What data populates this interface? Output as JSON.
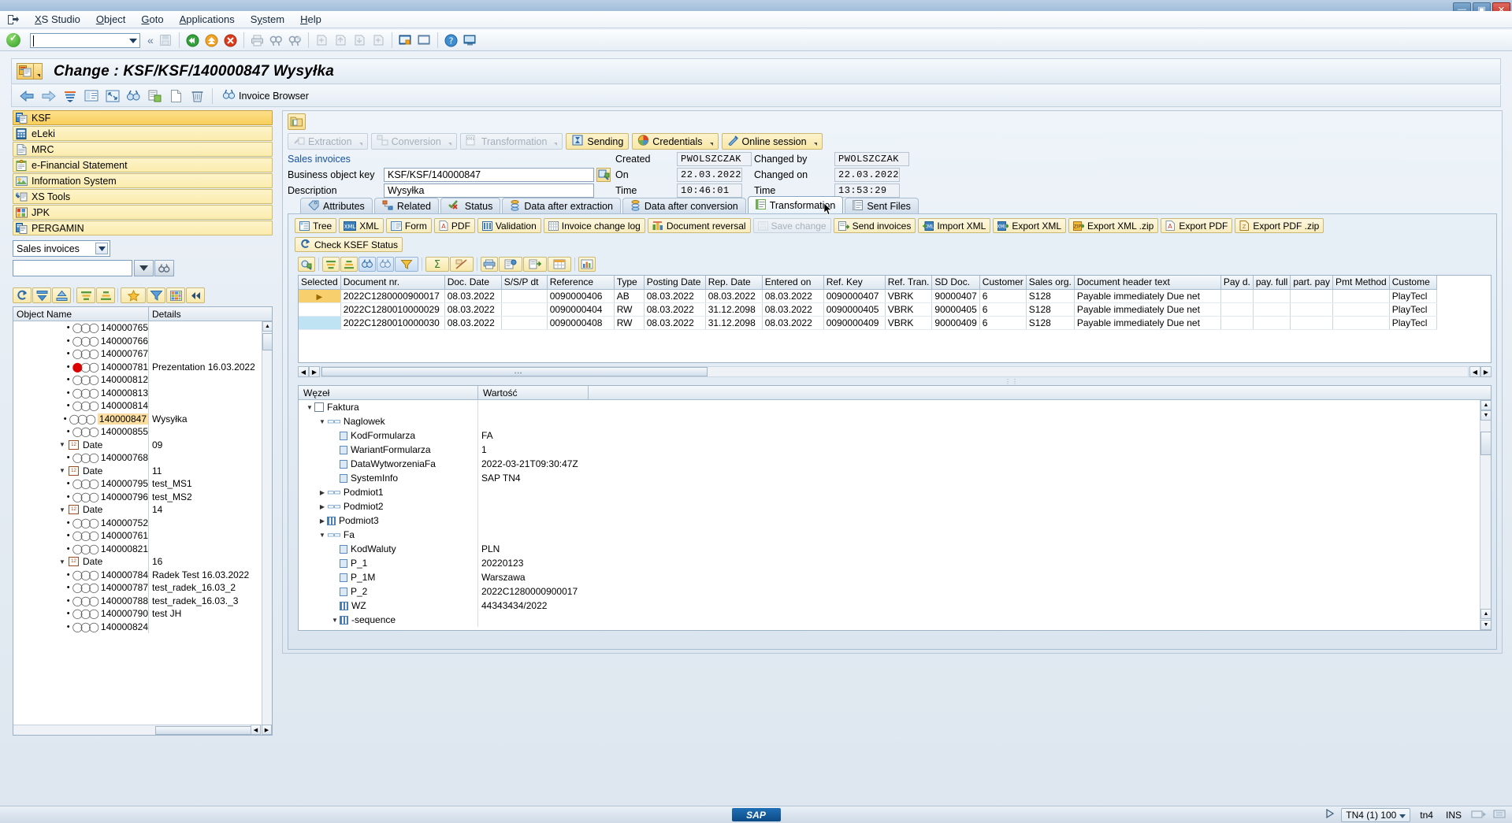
{
  "window": {
    "buttons": [
      "minimize",
      "maximize",
      "close"
    ]
  },
  "menubar": {
    "logo_icon": "sap-session-icon",
    "items": [
      "XS Studio",
      "Object",
      "Goto",
      "Applications",
      "System",
      "Help"
    ]
  },
  "toolbar": {
    "ok_icon": "green-check-icon",
    "command_field_value": "",
    "collapse_icon": "double-chevron-left-icon",
    "icons": [
      "save-icon",
      "back-icon",
      "exit-icon",
      "cancel-icon",
      "print-icon",
      "find-icon",
      "find-next-icon",
      "first-page-icon",
      "previous-page-icon",
      "next-page-icon",
      "last-page-icon",
      "create-session-icon",
      "create-shortcut-icon",
      "help-icon",
      "customize-icon"
    ]
  },
  "page": {
    "title": "Change : KSF/KSF/140000847 Wysyłka",
    "title_icon": "application-icon"
  },
  "app_toolbar": {
    "icons": [
      "back-arrow-icon",
      "forward-arrow-icon",
      "sort-icon",
      "detail-icon",
      "expand-icon",
      "find-binoculars-icon",
      "copy-document-icon",
      "new-document-icon",
      "delete-trash-icon"
    ],
    "invoice_browser": {
      "label": "Invoice Browser",
      "icon": "binoculars-icon"
    }
  },
  "sidebar": {
    "nav_items": [
      {
        "label": "KSF",
        "icon": "ksf-icon",
        "active": true
      },
      {
        "label": "eLeki",
        "icon": "eleki-icon",
        "active": false
      },
      {
        "label": "MRC",
        "icon": "mrc-document-icon",
        "active": false
      },
      {
        "label": "e-Financial Statement",
        "icon": "financial-statement-icon",
        "active": false
      },
      {
        "label": "Information System",
        "icon": "information-system-icon",
        "active": false
      },
      {
        "label": "XS Tools",
        "icon": "xs-tools-wrench-icon",
        "active": false
      },
      {
        "label": "JPK",
        "icon": "jpk-icon",
        "active": false
      },
      {
        "label": "PERGAMIN",
        "icon": "pergamin-icon",
        "active": false
      }
    ],
    "object_type_select": {
      "value": "Sales invoices",
      "dropdown_icon": "chevron-down-icon"
    },
    "search_value": "",
    "search_dropdown_icon": "chevron-down-icon",
    "search_button_icon": "binoculars-search-icon",
    "tree_toolbar_icons": [
      "refresh-icon",
      "expand-all-icon",
      "collapse-all-icon",
      "sort-ascending-icon",
      "sort-descending-icon",
      "favorites-star-icon",
      "filter-icon",
      "layout-grid-icon",
      "collapse-panel-icon"
    ],
    "tree": {
      "columns": [
        "Object Name",
        "Details"
      ],
      "rows": [
        {
          "indent": 2,
          "icon": "status-ooo-icon",
          "status": "none",
          "name": "140000765",
          "details": ""
        },
        {
          "indent": 2,
          "icon": "status-ooo-icon",
          "status": "none",
          "name": "140000766",
          "details": ""
        },
        {
          "indent": 2,
          "icon": "status-ooo-icon",
          "status": "none",
          "name": "140000767",
          "details": ""
        },
        {
          "indent": 2,
          "icon": "status-ooo-icon",
          "status": "red",
          "name": "140000781",
          "details": "Prezentation 16.03.2022"
        },
        {
          "indent": 2,
          "icon": "status-ooo-icon",
          "status": "none",
          "name": "140000812",
          "details": ""
        },
        {
          "indent": 2,
          "icon": "status-ooo-icon",
          "status": "none",
          "name": "140000813",
          "details": ""
        },
        {
          "indent": 2,
          "icon": "status-ooo-icon",
          "status": "none",
          "name": "140000814",
          "details": ""
        },
        {
          "indent": 2,
          "icon": "status-ooo-icon",
          "status": "none",
          "name": "140000847",
          "details": "Wysyłka",
          "selected": true
        },
        {
          "indent": 2,
          "icon": "status-ooo-icon",
          "status": "none",
          "name": "140000855",
          "details": ""
        },
        {
          "indent": 1,
          "icon": "date-folder-icon",
          "twisty": "expanded",
          "name": "Date",
          "details": "09"
        },
        {
          "indent": 2,
          "icon": "status-ooo-icon",
          "status": "none",
          "name": "140000768",
          "details": ""
        },
        {
          "indent": 1,
          "icon": "date-folder-icon",
          "twisty": "expanded",
          "name": "Date",
          "details": "11"
        },
        {
          "indent": 2,
          "icon": "status-ooo-icon",
          "status": "none",
          "name": "140000795",
          "details": "test_MS1"
        },
        {
          "indent": 2,
          "icon": "status-ooo-icon",
          "status": "none",
          "name": "140000796",
          "details": "test_MS2"
        },
        {
          "indent": 1,
          "icon": "date-folder-icon",
          "twisty": "expanded",
          "name": "Date",
          "details": "14"
        },
        {
          "indent": 2,
          "icon": "status-ooo-icon",
          "status": "none",
          "name": "140000752",
          "details": ""
        },
        {
          "indent": 2,
          "icon": "status-ooo-icon",
          "status": "none",
          "name": "140000761",
          "details": ""
        },
        {
          "indent": 2,
          "icon": "status-ooo-icon",
          "status": "none",
          "name": "140000821",
          "details": ""
        },
        {
          "indent": 1,
          "icon": "date-folder-icon",
          "twisty": "expanded",
          "name": "Date",
          "details": "16"
        },
        {
          "indent": 2,
          "icon": "status-ooo-icon",
          "status": "none",
          "name": "140000784",
          "details": "Radek Test 16.03.2022"
        },
        {
          "indent": 2,
          "icon": "status-ooo-icon",
          "status": "none",
          "name": "140000787",
          "details": "test_radek_16.03_2"
        },
        {
          "indent": 2,
          "icon": "status-ooo-icon",
          "status": "none",
          "name": "140000788",
          "details": "test_radek_16.03._3"
        },
        {
          "indent": 2,
          "icon": "status-ooo-icon",
          "status": "none",
          "name": "140000790",
          "details": "test JH"
        },
        {
          "indent": 2,
          "icon": "status-ooo-icon",
          "status": "none",
          "name": "140000824",
          "details": ""
        }
      ]
    }
  },
  "main": {
    "folder_icon": "open-folder-icon",
    "stages": [
      {
        "label": "Extraction",
        "icon": "extraction-icon",
        "enabled": false,
        "has_dropdown": true
      },
      {
        "label": "Conversion",
        "icon": "conversion-icon",
        "enabled": false,
        "has_dropdown": true
      },
      {
        "label": "Transformation",
        "icon": "transformation-xml-icon",
        "enabled": false,
        "has_dropdown": true
      },
      {
        "label": "Sending",
        "icon": "sending-icon",
        "enabled": true,
        "has_dropdown": false
      },
      {
        "label": "Credentials",
        "icon": "credentials-pie-icon",
        "enabled": true,
        "has_dropdown": true
      },
      {
        "label": "Online session",
        "icon": "online-session-icon",
        "enabled": true,
        "has_dropdown": true
      }
    ],
    "form": {
      "object_link": "Sales invoices",
      "business_object_key_label": "Business object key",
      "business_object_key_value": "KSF/KSF/140000847",
      "description_label": "Description",
      "description_value": "Wysyłka",
      "search_icon": "search-help-icon",
      "created_label": "Created",
      "created_value": "PWOLSZCZAK",
      "on_label": "On",
      "on_value": "22.03.2022",
      "time_label": "Time",
      "time_value": "10:46:01",
      "changed_by_label": "Changed by",
      "changed_by_value": "PWOLSZCZAK",
      "changed_on_label": "Changed on",
      "changed_on_value": "22.03.2022",
      "changed_time_label": "Time",
      "changed_time_value": "13:53:29"
    },
    "tabs": [
      {
        "label": "Attributes",
        "icon": "attributes-tag-icon",
        "active": false
      },
      {
        "label": "Related",
        "icon": "related-nodes-icon",
        "active": false
      },
      {
        "label": "Status",
        "icon": "status-check-icon",
        "active": false
      },
      {
        "label": "Data after extraction",
        "icon": "data-stack-icon",
        "active": false
      },
      {
        "label": "Data after conversion",
        "icon": "data-stack-icon",
        "active": false
      },
      {
        "label": "Transformation",
        "icon": "transformation-list-icon",
        "active": true
      },
      {
        "label": "Sent Files",
        "icon": "sent-files-icon",
        "active": false
      }
    ],
    "action_buttons": [
      {
        "label": "Tree",
        "icon": "tree-icon",
        "enabled": true
      },
      {
        "label": "XML",
        "icon": "xml-icon",
        "enabled": true
      },
      {
        "label": "Form",
        "icon": "form-icon",
        "enabled": true
      },
      {
        "label": "PDF",
        "icon": "pdf-icon",
        "enabled": true
      },
      {
        "label": "Validation",
        "icon": "validation-icon",
        "enabled": true
      },
      {
        "label": "Invoice change log",
        "icon": "change-log-icon",
        "enabled": true
      },
      {
        "label": "Document reversal",
        "icon": "document-reversal-icon",
        "enabled": true
      },
      {
        "label": "Save change",
        "icon": "save-icon",
        "enabled": false
      },
      {
        "label": "Send invoices",
        "icon": "send-invoices-icon",
        "enabled": true
      },
      {
        "label": "Import XML",
        "icon": "import-xml-icon",
        "enabled": true
      },
      {
        "label": "Export XML",
        "icon": "export-xml-icon",
        "enabled": true
      },
      {
        "label": "Export XML .zip",
        "icon": "export-xml-zip-icon",
        "enabled": true
      },
      {
        "label": "Export PDF",
        "icon": "export-pdf-icon",
        "enabled": true
      },
      {
        "label": "Export PDF .zip",
        "icon": "export-pdf-zip-icon",
        "enabled": true
      }
    ],
    "action_buttons_row2": [
      {
        "label": "Check KSEF Status",
        "icon": "refresh-status-icon",
        "enabled": true
      }
    ],
    "grid_toolbar_icons": [
      "details-search-icon",
      "sort-ascending-icon",
      "sort-descending-icon",
      "find-icon",
      "find-next-icon",
      "filter-icon",
      "total-sum-icon",
      "subtotal-icon",
      "print-icon",
      "export-local-file-icon",
      "mail-export-icon",
      "spreadsheet-icon",
      "graphic-chart-icon"
    ],
    "grid": {
      "columns": [
        "Selected",
        "Document nr.",
        "Doc. Date",
        "S/S/P dt",
        "Reference",
        "Type",
        "Posting Date",
        "Rep. Date",
        "Entered on",
        "Ref. Key",
        "Ref. Tran.",
        "SD Doc.",
        "Customer",
        "Sales org.",
        "Document header text",
        "Pay d.",
        "pay. full",
        "part. pay",
        "Pmt Method",
        "Custome"
      ],
      "rows": [
        {
          "selected": true,
          "cells": [
            "2022C1280000900017",
            "08.03.2022",
            "",
            "0090000406",
            "AB",
            "08.03.2022",
            "08.03.2022",
            "08.03.2022",
            "0090000407",
            "VBRK",
            "90000407",
            "6",
            "S128",
            "Payable immediately Due net",
            "",
            "",
            "",
            "",
            "PlayTecl"
          ]
        },
        {
          "selected": false,
          "cells": [
            "2022C1280010000029",
            "08.03.2022",
            "",
            "0090000404",
            "RW",
            "08.03.2022",
            "31.12.2098",
            "08.03.2022",
            "0090000405",
            "VBRK",
            "90000405",
            "6",
            "S128",
            "Payable immediately Due net",
            "",
            "",
            "",
            "",
            "PlayTecl"
          ]
        },
        {
          "selected": false,
          "highlighted": true,
          "cells": [
            "2022C1280010000030",
            "08.03.2022",
            "",
            "0090000408",
            "RW",
            "08.03.2022",
            "31.12.2098",
            "08.03.2022",
            "0090000409",
            "VBRK",
            "90000409",
            "6",
            "S128",
            "Payable immediately Due net",
            "",
            "",
            "",
            "",
            "PlayTecl"
          ]
        }
      ]
    },
    "xml_tree": {
      "columns": [
        "Węzeł",
        "Wartość"
      ],
      "rows": [
        {
          "indent": 0,
          "twisty": "expanded",
          "icon": "xml-document-icon",
          "node": "Faktura",
          "value": ""
        },
        {
          "indent": 1,
          "twisty": "expanded",
          "icon": "xml-element-icon",
          "node": "Naglowek",
          "value": ""
        },
        {
          "indent": 2,
          "twisty": "none",
          "icon": "xml-attribute-icon",
          "node": "KodFormularza",
          "value": "FA"
        },
        {
          "indent": 2,
          "twisty": "none",
          "icon": "xml-attribute-icon",
          "node": "WariantFormularza",
          "value": "1"
        },
        {
          "indent": 2,
          "twisty": "none",
          "icon": "xml-attribute-icon",
          "node": "DataWytworzeniaFa",
          "value": "2022-03-21T09:30:47Z"
        },
        {
          "indent": 2,
          "twisty": "none",
          "icon": "xml-attribute-icon",
          "node": "SystemInfo",
          "value": "SAP TN4"
        },
        {
          "indent": 1,
          "twisty": "collapsed",
          "icon": "xml-element-icon",
          "node": "Podmiot1",
          "value": ""
        },
        {
          "indent": 1,
          "twisty": "collapsed",
          "icon": "xml-element-icon",
          "node": "Podmiot2",
          "value": ""
        },
        {
          "indent": 1,
          "twisty": "collapsed",
          "icon": "xml-table-icon",
          "node": "Podmiot3",
          "value": ""
        },
        {
          "indent": 1,
          "twisty": "expanded",
          "icon": "xml-element-icon",
          "node": "Fa",
          "value": ""
        },
        {
          "indent": 2,
          "twisty": "none",
          "icon": "xml-attribute-icon",
          "node": "KodWaluty",
          "value": "PLN"
        },
        {
          "indent": 2,
          "twisty": "none",
          "icon": "xml-attribute-icon",
          "node": "P_1",
          "value": "20220123"
        },
        {
          "indent": 2,
          "twisty": "none",
          "icon": "xml-attribute-icon",
          "node": "P_1M",
          "value": "Warszawa"
        },
        {
          "indent": 2,
          "twisty": "none",
          "icon": "xml-attribute-icon",
          "node": "P_2",
          "value": "2022C1280000900017"
        },
        {
          "indent": 2,
          "twisty": "none",
          "icon": "xml-table-icon",
          "node": "WZ",
          "value": "44343434/2022"
        },
        {
          "indent": 2,
          "twisty": "expanded",
          "icon": "xml-table-icon",
          "node": "-sequence",
          "value": ""
        }
      ]
    }
  },
  "statusbar": {
    "sap_logo": "SAP",
    "run_icon": "play-icon",
    "system": "TN4 (1) 100",
    "system_dropdown_icon": "chevron-down-icon",
    "server": "tn4",
    "mode": "INS",
    "right_icons": [
      "scroll-lock-icon",
      "resize-grip-icon"
    ]
  }
}
